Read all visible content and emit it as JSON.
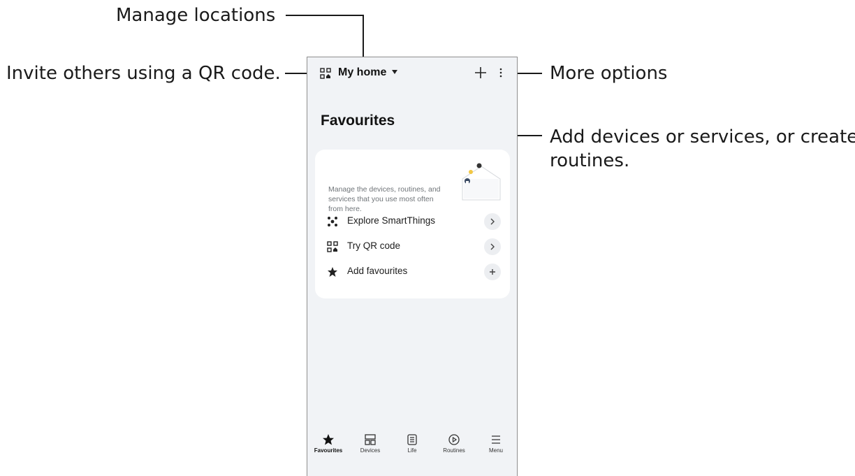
{
  "callouts": {
    "manage_locations": "Manage locations",
    "invite_qr": "Invite others using a QR code.",
    "more_options": "More options",
    "add_devices_line1": "Add devices or services, or create",
    "add_devices_line2": "routines."
  },
  "header": {
    "title": "My home",
    "qr_icon": "qr-code-icon",
    "add_icon": "plus-icon",
    "more_icon": "more-vertical-icon"
  },
  "main": {
    "title": "Favourites",
    "card": {
      "description": "Manage the devices, routines, and services that you use most often from here.",
      "items": [
        {
          "label": "Explore SmartThings",
          "icon": "smartthings-icon",
          "action": "chevron-right-icon"
        },
        {
          "label": "Try QR code",
          "icon": "qr-code-icon",
          "action": "chevron-right-icon"
        },
        {
          "label": "Add favourites",
          "icon": "star-icon",
          "action": "plus-icon"
        }
      ]
    }
  },
  "nav": {
    "items": [
      {
        "label": "Favourites",
        "icon": "star-icon",
        "active": true
      },
      {
        "label": "Devices",
        "icon": "devices-icon",
        "active": false
      },
      {
        "label": "Life",
        "icon": "life-icon",
        "active": false
      },
      {
        "label": "Routines",
        "icon": "routines-icon",
        "active": false
      },
      {
        "label": "Menu",
        "icon": "menu-icon",
        "active": false
      }
    ]
  },
  "colors": {
    "screen_bg": "#f1f3f6",
    "card_bg": "#ffffff",
    "callout_text": "#1a1a1a"
  }
}
